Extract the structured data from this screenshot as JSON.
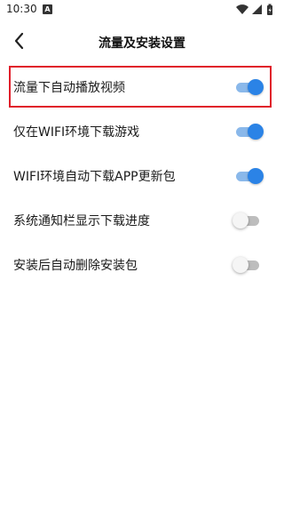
{
  "status_bar": {
    "time": "10:30",
    "notification_badge": "A",
    "icons": [
      "wifi-icon",
      "signal-icon",
      "battery-icon"
    ]
  },
  "header": {
    "title": "流量及安装设置",
    "back_icon": "chevron-left-icon"
  },
  "settings": [
    {
      "label": "流量下自动播放视频",
      "enabled": true,
      "highlighted": true
    },
    {
      "label": "仅在WIFI环境下载游戏",
      "enabled": true,
      "highlighted": false
    },
    {
      "label": "WIFI环境自动下载APP更新包",
      "enabled": true,
      "highlighted": false
    },
    {
      "label": "系统通知栏显示下载进度",
      "enabled": false,
      "highlighted": false
    },
    {
      "label": "安装后自动删除安装包",
      "enabled": false,
      "highlighted": false
    }
  ],
  "colors": {
    "toggle_on_knob": "#2b83e6",
    "toggle_on_track": "#8ab8ea",
    "toggle_off_track": "#bdbdbd",
    "highlight_border": "#e01e2a"
  }
}
